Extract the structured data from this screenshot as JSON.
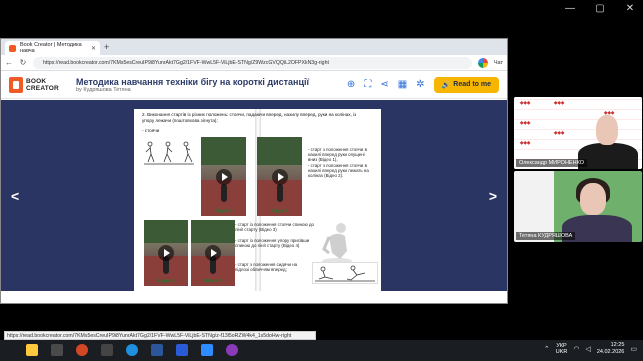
{
  "window_controls": [
    "—",
    "▢",
    "✕"
  ],
  "browser": {
    "tab_title": "Book Creator | Методика навча",
    "tab_close": "✕",
    "new_tab": "+",
    "url": "https://read.bookcreator.com/7KMs5esCreuIP9i8YunrAkt7Gg2/1FVF-WwL5F-ViLjbE-STNg/Z9WzcGVQQiL2OFPXkN3g-right",
    "chat_label": "Чат",
    "status_url": "https://read.bookcreator.com/7KMs5esCreuIP9i8YunrAkt7Gg2/1FVF-WwL5F-ViLjbE-STNg/z-f13l5oRZW4k4_1s5doHw-right"
  },
  "bookcreator": {
    "logo_text_line1": "BOOK",
    "logo_text_line2": "CREATOR",
    "title": "Методика навчання техніки бігу на короткі дистанції",
    "author": "by Кудряшова Тетяна",
    "read_btn": "Read to me",
    "icons": [
      "zoom-in-icon",
      "fullscreen-icon",
      "share-icon",
      "pages-icon",
      "settings-icon"
    ]
  },
  "page": {
    "heading": "2. Виконання стартів із різних положень: стоячи, падаючи вперед, нахилу вперед, руки на колінах, із упору лежачи (поштовхова зігнута);",
    "sub": "- стоячи",
    "note_right": "- старт з положення стоячи в нахилі вперед руки опущені вниз (Відео 1),\n- старт з положення стоячи в нахилі вперед руки лежать на колінах (Відео 2).",
    "note_bl1": "- старт із положення стоячи спиною до лінії старту (Відео 3)",
    "note_bl2": "- старт із положення упору присівши спиною до лінії старту (Відео 4)",
    "note_bl3": "- старт з положення сидячи на підлозі обличчям вперед;",
    "videos": [
      "Відео 1",
      "Відео 2",
      "Відео 3",
      "Відео 4"
    ]
  },
  "participants": [
    {
      "name": "Олександр МИРОНЕНКО"
    },
    {
      "name": "Тетяна КУДРЯШОВА"
    }
  ],
  "taskbar": {
    "lang": "УКР",
    "lang2": "UKR",
    "time": "12:25",
    "date": "24.02.2026"
  },
  "colors": {
    "bookcreator_accent": "#f15a24",
    "stage_bg": "#2b3563",
    "read_button": "#f5b500"
  }
}
